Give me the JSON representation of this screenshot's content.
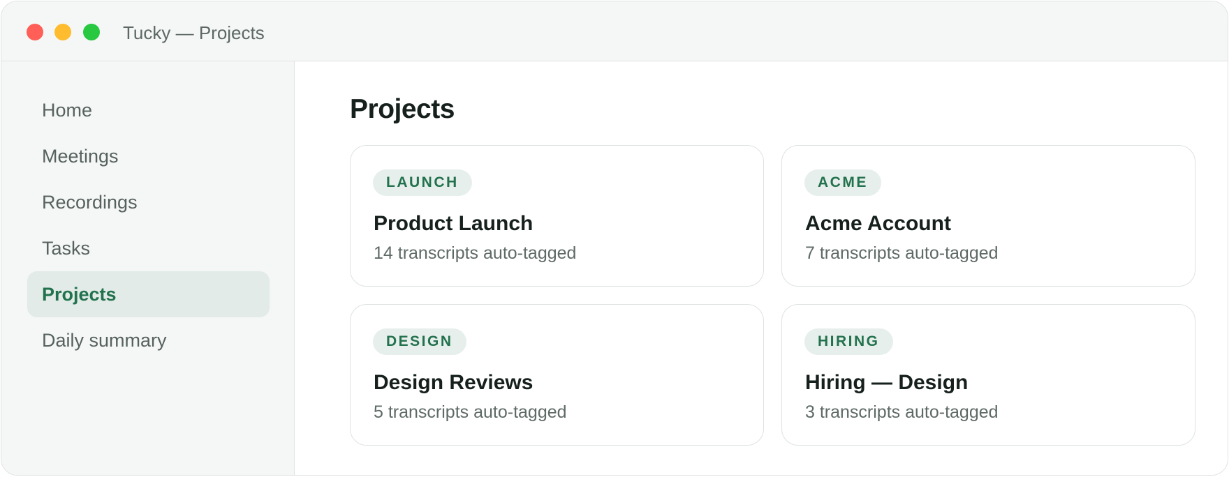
{
  "window": {
    "title": "Tucky — Projects"
  },
  "sidebar": {
    "items": [
      {
        "label": "Home",
        "active": false
      },
      {
        "label": "Meetings",
        "active": false
      },
      {
        "label": "Recordings",
        "active": false
      },
      {
        "label": "Tasks",
        "active": false
      },
      {
        "label": "Projects",
        "active": true
      },
      {
        "label": "Daily summary",
        "active": false
      }
    ]
  },
  "main": {
    "title": "Projects",
    "projects": [
      {
        "tag": "LAUNCH",
        "name": "Product Launch",
        "summary": "14 transcripts auto-tagged"
      },
      {
        "tag": "ACME",
        "name": "Acme Account",
        "summary": "7 transcripts auto-tagged"
      },
      {
        "tag": "DESIGN",
        "name": "Design Reviews",
        "summary": "5 transcripts auto-tagged"
      },
      {
        "tag": "HIRING",
        "name": "Hiring — Design",
        "summary": "3 transcripts auto-tagged"
      }
    ]
  },
  "colors": {
    "accent": "#23724e",
    "active_nav_bg": "#e2ebe7",
    "tag_bg": "#e6efeb",
    "chrome_bg": "#f5f7f6",
    "close": "#ff5f57",
    "minimize": "#febc2e",
    "zoom": "#28c840"
  }
}
